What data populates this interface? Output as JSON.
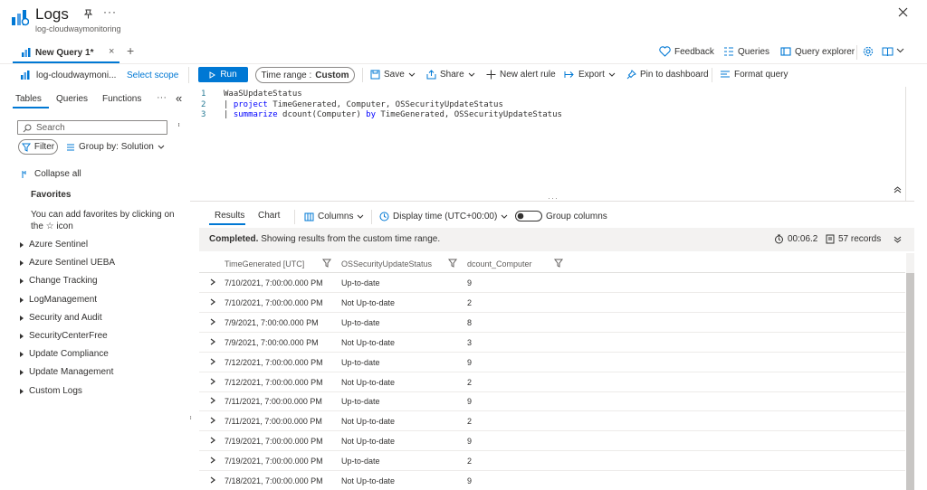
{
  "header": {
    "title": "Logs",
    "subtitle": "log-cloudwaymonitoring",
    "more": "···"
  },
  "tabs": [
    {
      "label": "New Query 1*",
      "close": "×"
    }
  ],
  "tab_add": "+",
  "top_actions": {
    "feedback": "Feedback",
    "queries": "Queries",
    "query_explorer": "Query explorer"
  },
  "toolbar": {
    "scope_label": "log-cloudwaymoni...",
    "select_scope": "Select scope",
    "run": "Run",
    "time_range_prefix": "Time range :",
    "time_range_value": "Custom",
    "save": "Save",
    "share": "Share",
    "new_alert_rule": "New alert rule",
    "export": "Export",
    "pin_to_dashboard": "Pin to dashboard",
    "format_query": "Format query"
  },
  "left_panel": {
    "tabs": [
      "Tables",
      "Queries",
      "Functions"
    ],
    "more": "···",
    "collapse_panel": "«",
    "search_placeholder": "Search",
    "filter": "Filter",
    "group_by": "Group by: Solution",
    "collapse_all": "Collapse all",
    "favorites_title": "Favorites",
    "favorites_hint": "You can add favorites by clicking on the ☆ icon",
    "tree": [
      "Azure Sentinel",
      "Azure Sentinel UEBA",
      "Change Tracking",
      "LogManagement",
      "Security and Audit",
      "SecurityCenterFree",
      "Update Compliance",
      "Update Management",
      "Custom Logs"
    ]
  },
  "editor": {
    "lines": [
      {
        "num": "1",
        "parts": [
          {
            "t": "WaaSUpdateStatus",
            "k": false
          }
        ]
      },
      {
        "num": "2",
        "parts": [
          {
            "t": "| ",
            "k": false
          },
          {
            "t": "project",
            "k": true
          },
          {
            "t": " TimeGenerated, Computer, OSSecurityUpdateStatus",
            "k": false
          }
        ]
      },
      {
        "num": "3",
        "parts": [
          {
            "t": "| ",
            "k": false
          },
          {
            "t": "summarize",
            "k": true
          },
          {
            "t": " dcount(Computer) ",
            "k": false
          },
          {
            "t": "by",
            "k": true
          },
          {
            "t": " TimeGenerated, OSSecurityUpdateStatus",
            "k": false
          }
        ]
      }
    ]
  },
  "results": {
    "tabs": [
      "Results",
      "Chart"
    ],
    "columns_btn": "Columns",
    "display_time": "Display time (UTC+00:00)",
    "group_columns": "Group columns",
    "status_bold": "Completed.",
    "status_text": " Showing results from the custom time range.",
    "duration": "00:06.2",
    "records": "57 records",
    "columns": [
      "TimeGenerated [UTC]",
      "OSSecurityUpdateStatus",
      "dcount_Computer"
    ],
    "rows": [
      [
        "7/10/2021, 7:00:00.000 PM",
        "Up-to-date",
        "9"
      ],
      [
        "7/10/2021, 7:00:00.000 PM",
        "Not Up-to-date",
        "2"
      ],
      [
        "7/9/2021, 7:00:00.000 PM",
        "Up-to-date",
        "8"
      ],
      [
        "7/9/2021, 7:00:00.000 PM",
        "Not Up-to-date",
        "3"
      ],
      [
        "7/12/2021, 7:00:00.000 PM",
        "Up-to-date",
        "9"
      ],
      [
        "7/12/2021, 7:00:00.000 PM",
        "Not Up-to-date",
        "2"
      ],
      [
        "7/11/2021, 7:00:00.000 PM",
        "Up-to-date",
        "9"
      ],
      [
        "7/11/2021, 7:00:00.000 PM",
        "Not Up-to-date",
        "2"
      ],
      [
        "7/19/2021, 7:00:00.000 PM",
        "Not Up-to-date",
        "9"
      ],
      [
        "7/19/2021, 7:00:00.000 PM",
        "Up-to-date",
        "2"
      ],
      [
        "7/18/2021, 7:00:00.000 PM",
        "Not Up-to-date",
        "9"
      ]
    ]
  },
  "colors": {
    "accent": "#0078d4",
    "keyword": "#0000ff",
    "line_number": "#237893"
  }
}
